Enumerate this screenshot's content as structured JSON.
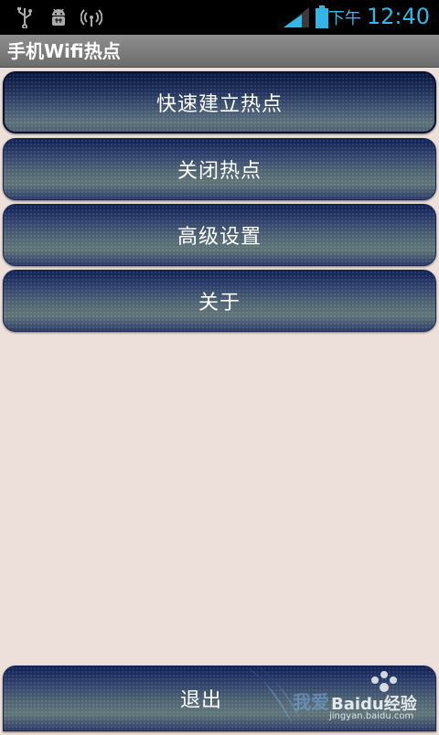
{
  "status_bar": {
    "icons": [
      "usb-icon",
      "android-debug-icon",
      "wifi-hotspot-icon"
    ],
    "time_prefix": "下午",
    "time": "12:40",
    "accent_color": "#33b5e5"
  },
  "app": {
    "title": "手机Wifi热点"
  },
  "menu": {
    "items": [
      {
        "label": "快速建立热点"
      },
      {
        "label": "关闭热点"
      },
      {
        "label": "高级设置"
      },
      {
        "label": "关于"
      }
    ],
    "exit_label": "退出"
  },
  "watermark": {
    "text": "我爱",
    "brand": "Baidu经验",
    "url": "jingyan.baidu.com"
  }
}
